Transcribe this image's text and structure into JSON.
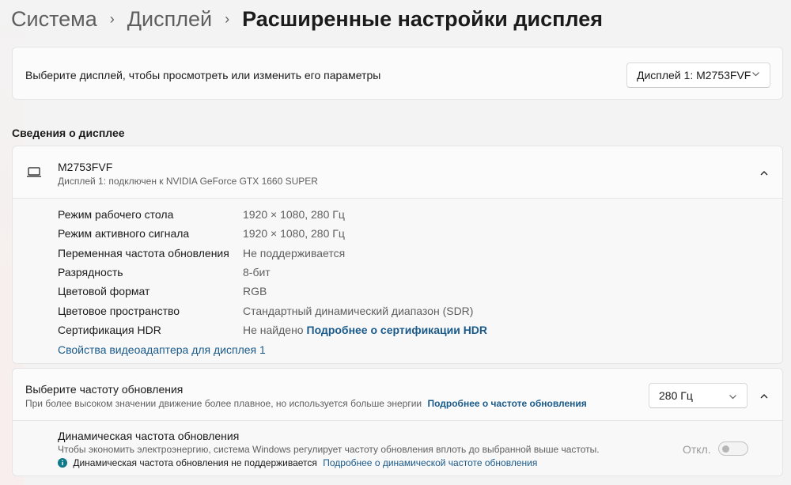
{
  "breadcrumb": {
    "items": [
      "Система",
      "Дисплей",
      "Расширенные настройки дисплея"
    ],
    "separator": "›"
  },
  "select_display": {
    "label": "Выберите дисплей, чтобы просмотреть или изменить его параметры",
    "dropdown_value": "Дисплей 1: M2753FVF"
  },
  "display_info": {
    "section_title": "Сведения о дисплее",
    "monitor_name": "M2753FVF",
    "monitor_subtitle": "Дисплей 1: подключен к NVIDIA GeForce GTX 1660 SUPER",
    "rows": [
      {
        "label": "Режим рабочего стола",
        "value": "1920 × 1080, 280 Гц"
      },
      {
        "label": "Режим активного сигнала",
        "value": "1920 × 1080, 280 Гц"
      },
      {
        "label": "Переменная частота обновления",
        "value": "Не поддерживается"
      },
      {
        "label": "Разрядность",
        "value": "8-бит"
      },
      {
        "label": "Цветовой формат",
        "value": "RGB"
      },
      {
        "label": "Цветовое пространство",
        "value": "Стандартный динамический диапазон (SDR)"
      },
      {
        "label": "Сертификация HDR",
        "value": "Не найдено",
        "link": "Подробнее о сертификации HDR"
      }
    ],
    "adapter_link": "Свойства видеоадаптера для дисплея 1"
  },
  "refresh_rate": {
    "title": "Выберите частоту обновления",
    "description": "При более высоком значении движение более плавное, но используется больше энергии",
    "link": "Подробнее о частоте обновления",
    "dropdown_value": "280 Гц"
  },
  "dynamic_refresh": {
    "title": "Динамическая частота обновления",
    "description": "Чтобы экономить электроэнергию, система Windows регулирует частоту обновления вплоть до выбранной выше частоты.",
    "notice": "Динамическая частота обновления не поддерживается",
    "notice_link": "Подробнее о динамической частоте обновления",
    "toggle_state": "Откл.",
    "toggle_on": false
  },
  "colors": {
    "accent_link": "#1a5a8a",
    "info_icon": "#0e7a8a"
  }
}
